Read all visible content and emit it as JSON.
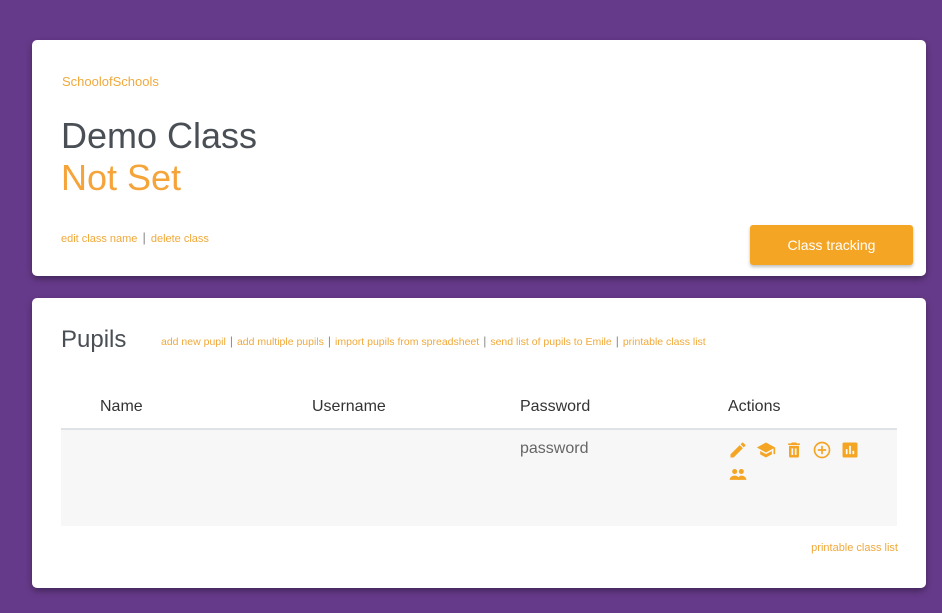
{
  "colors": {
    "background": "#663a8a",
    "accent": "#f5a524",
    "title": "#4a4f55"
  },
  "header": {
    "org_link": "SchoolofSchools",
    "class_title": "Demo Class",
    "class_subtitle": "Not Set",
    "links": {
      "edit": "edit class name",
      "delete": "delete class",
      "separator": "|"
    },
    "tracking_button": "Class tracking"
  },
  "pupils": {
    "title": "Pupils",
    "links": [
      "add new pupil",
      "add multiple pupils",
      "import pupils from spreadsheet",
      "send list of pupils to Emile",
      "printable class list"
    ],
    "separator": "|",
    "columns": [
      "Name",
      "Username",
      "Password",
      "Actions"
    ],
    "rows": [
      {
        "name": "",
        "username": "",
        "password": "password",
        "actions": [
          "pencil-icon",
          "graduation-cap-icon",
          "trash-icon",
          "plus-circle-icon",
          "bar-chart-icon",
          "group-icon"
        ]
      }
    ],
    "footer_link": "printable class list"
  }
}
